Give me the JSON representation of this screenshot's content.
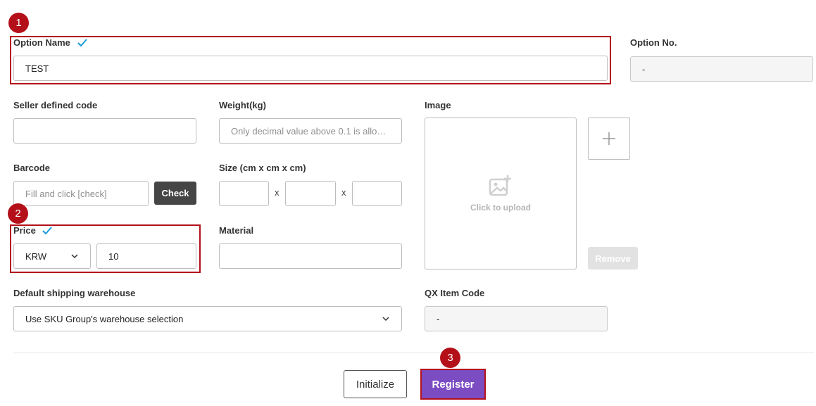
{
  "colors": {
    "accent": "#7b4cc2",
    "annotation": "#b3101a",
    "checkmark": "#1a9bd7"
  },
  "annotations": [
    "1",
    "2",
    "3"
  ],
  "option_name": {
    "label": "Option Name",
    "value": "TEST",
    "check_icon": "check-icon"
  },
  "option_no": {
    "label": "Option No.",
    "value": "-"
  },
  "seller_code": {
    "label": "Seller defined code",
    "value": ""
  },
  "weight": {
    "label": "Weight(kg)",
    "placeholder": "Only decimal value above 0.1 is allow..."
  },
  "image": {
    "label": "Image",
    "upload_text": "Click to upload",
    "upload_icon": "image-add-icon",
    "add_icon": "plus-icon",
    "remove_label": "Remove"
  },
  "barcode": {
    "label": "Barcode",
    "placeholder": "Fill and click [check]",
    "check_label": "Check"
  },
  "size": {
    "label": "Size (cm x cm x cm)",
    "separators": [
      "x",
      "x"
    ]
  },
  "price": {
    "label": "Price",
    "currency": "KRW",
    "value": "10",
    "check_icon": "check-icon"
  },
  "material": {
    "label": "Material",
    "value": ""
  },
  "warehouse": {
    "label": "Default shipping warehouse",
    "value": "Use SKU Group's warehouse selection"
  },
  "qx_item_code": {
    "label": "QX Item Code",
    "value": "-"
  },
  "actions": {
    "initialize_label": "Initialize",
    "register_label": "Register"
  }
}
